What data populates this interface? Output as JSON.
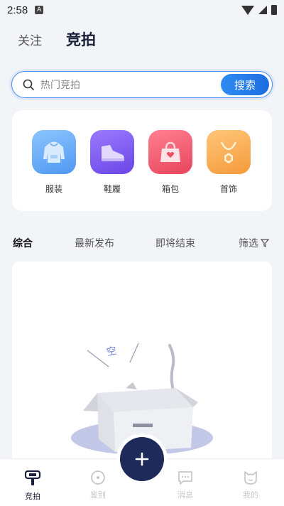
{
  "status_bar": {
    "time": "2:58",
    "notification_letter": "A"
  },
  "top_tabs": [
    {
      "label": "关注",
      "active": false
    },
    {
      "label": "竞拍",
      "active": true
    }
  ],
  "search": {
    "placeholder": "热门竞拍",
    "button_label": "搜索"
  },
  "categories": [
    {
      "label": "服装",
      "icon": "hoodie-icon",
      "color": "#5aa4f6"
    },
    {
      "label": "鞋履",
      "icon": "sneaker-icon",
      "color": "#7a5cf0"
    },
    {
      "label": "箱包",
      "icon": "handbag-icon",
      "color": "#f0566a"
    },
    {
      "label": "首饰",
      "icon": "necklace-icon",
      "color": "#f7a64a"
    }
  ],
  "filters": [
    {
      "label": "综合",
      "active": true
    },
    {
      "label": "最新发布",
      "active": false
    },
    {
      "label": "即将结束",
      "active": false
    },
    {
      "label": "筛选",
      "active": false,
      "icon": "filter-icon"
    }
  ],
  "empty_state": {
    "box_text": "空"
  },
  "bottom_nav": [
    {
      "label": "竞拍",
      "icon": "gavel-icon",
      "active": true
    },
    {
      "label": "鉴别",
      "icon": "identify-icon",
      "active": false
    },
    {
      "label": "消息",
      "icon": "message-icon",
      "active": false
    },
    {
      "label": "我的",
      "icon": "profile-cat-icon",
      "active": false
    }
  ],
  "fab": {
    "icon": "plus-icon"
  },
  "colors": {
    "accent": "#1e2a5a",
    "search_border": "#4a8ee8",
    "button_blue": "#2f8cf2"
  }
}
